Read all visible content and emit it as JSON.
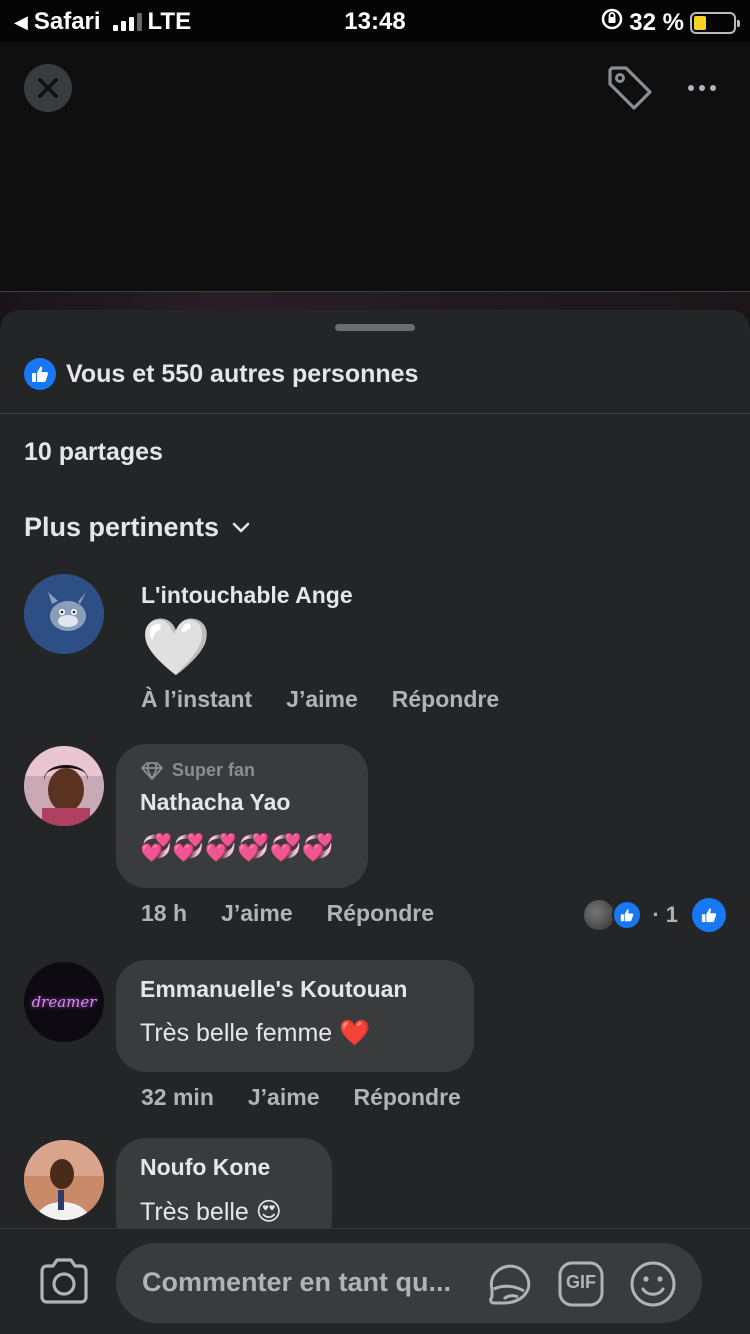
{
  "status_bar": {
    "back_app": "Safari",
    "network": "LTE",
    "time": "13:48",
    "battery": "32 %"
  },
  "post": {
    "likes_text": "Vous et 550 autres personnes",
    "shares_text": "10 partages",
    "sort_label": "Plus pertinents"
  },
  "comments": [
    {
      "name": "L'intouchable Ange",
      "text": "🤍",
      "time": "À l’instant",
      "like_label": "J’aime",
      "reply_label": "Répondre"
    },
    {
      "badge": "Super fan",
      "name": "Nathacha Yao",
      "text": "💞💞💞💞💞💞",
      "time": "18 h",
      "like_label": "J’aime",
      "reply_label": "Répondre",
      "reaction_count": "· 1"
    },
    {
      "name": "Emmanuelle's Koutouan",
      "text": "Très belle femme ❤️",
      "time": "32 min",
      "like_label": "J’aime",
      "reply_label": "Répondre",
      "avatar_text": "dreamer"
    },
    {
      "name": "Noufo Kone",
      "text": "Très belle 😍"
    }
  ],
  "composer": {
    "placeholder": "Commenter en tant qu...",
    "gif_label": "GIF"
  },
  "colors": {
    "accent": "#1877f2",
    "sheet_bg": "#242526",
    "bubble_bg": "#3a3b3c"
  }
}
